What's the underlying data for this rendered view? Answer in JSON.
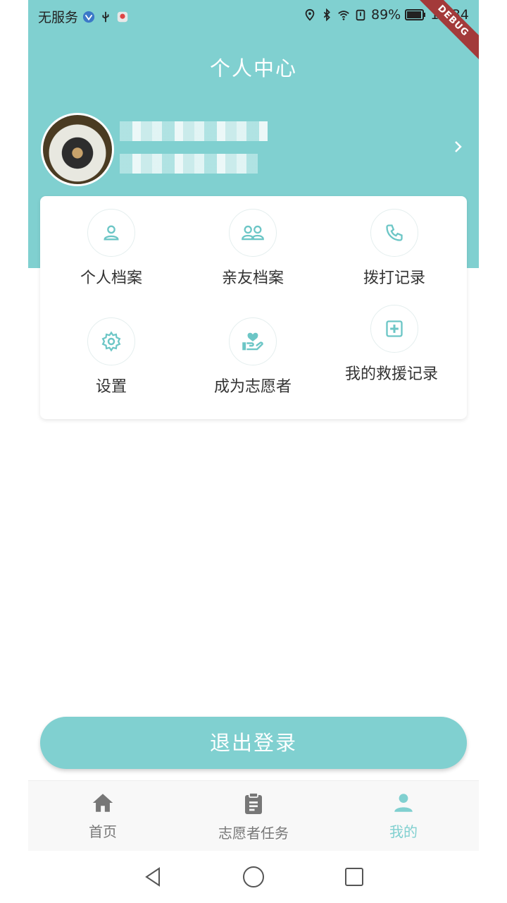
{
  "status_bar": {
    "carrier": "无服务",
    "battery": "89%",
    "time": "10:34",
    "debug_label": "DEBUG"
  },
  "header": {
    "title": "个人中心"
  },
  "grid": [
    {
      "label": "个人档案",
      "icon": "person-icon"
    },
    {
      "label": "亲友档案",
      "icon": "group-icon"
    },
    {
      "label": "拨打记录",
      "icon": "phone-icon"
    },
    {
      "label": "设置",
      "icon": "gear-icon"
    },
    {
      "label": "成为志愿者",
      "icon": "heart-hand-icon"
    },
    {
      "label": "我的救援记录",
      "icon": "medical-plus-icon"
    }
  ],
  "logout": {
    "label": "退出登录"
  },
  "bottom_nav": [
    {
      "label": "首页",
      "icon": "home-icon",
      "active": false
    },
    {
      "label": "志愿者任务",
      "icon": "clipboard-icon",
      "active": false
    },
    {
      "label": "我的",
      "icon": "person-icon",
      "active": true
    }
  ],
  "colors": {
    "accent": "#80d0d0",
    "nav_inactive": "#777777",
    "nav_active": "#80d0d0",
    "icon_teal": "#6cc6c6"
  }
}
